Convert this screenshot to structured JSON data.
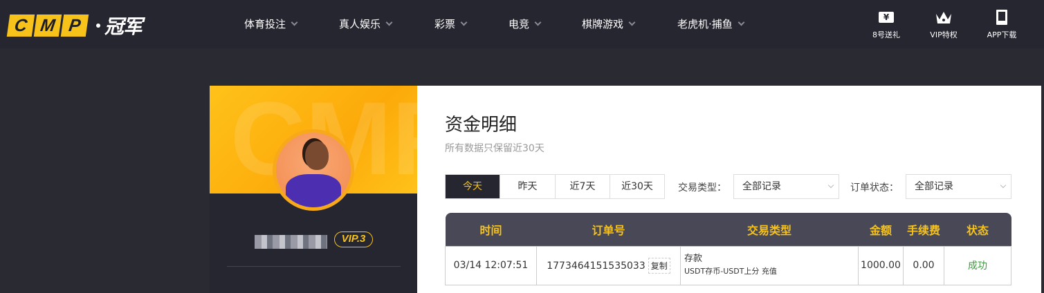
{
  "header": {
    "logo": {
      "letters": [
        "C",
        "M",
        "P"
      ],
      "cn": "冠军"
    },
    "nav": [
      "体育投注",
      "真人娱乐",
      "彩票",
      "电竞",
      "棋牌游戏",
      "老虎机·捕鱼"
    ],
    "quick": [
      {
        "label": "8号送礼",
        "icon": "ticket-yen-icon"
      },
      {
        "label": "VIP特权",
        "icon": "crown-icon"
      },
      {
        "label": "APP下载",
        "icon": "tablet-icon"
      }
    ]
  },
  "profile": {
    "banner_watermark": "CMP",
    "vip": "VIP.3"
  },
  "main": {
    "title": "资金明细",
    "subtitle": "所有数据只保留近30天",
    "tabs": [
      "今天",
      "昨天",
      "近7天",
      "近30天"
    ],
    "active_tab": "今天",
    "filters": [
      {
        "label": "交易类型：",
        "value": "全部记录"
      },
      {
        "label": "订单状态：",
        "value": "全部记录"
      }
    ],
    "table": {
      "headers": [
        "时间",
        "订单号",
        "交易类型",
        "金额",
        "手续费",
        "状态"
      ],
      "rows": [
        {
          "time": "03/14 12:07:51",
          "order": "1773464151535033",
          "copy": "复制",
          "type": "存款",
          "type_detail": "USDT存币-USDT上分 充值",
          "amount": "1000.00",
          "fee": "0.00",
          "status": "成功"
        }
      ]
    }
  },
  "colors": {
    "accent": "#f7c21a",
    "bg": "#2a2a33",
    "success": "#3a9a3a"
  }
}
